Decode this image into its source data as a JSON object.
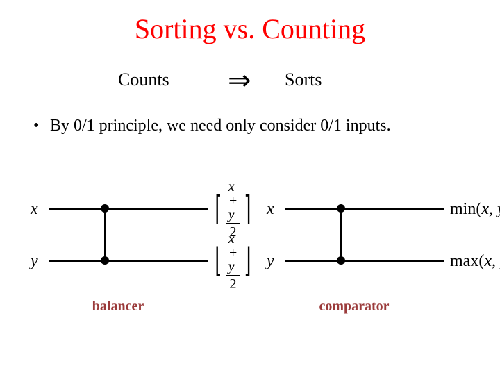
{
  "title": "Sorting vs. Counting",
  "implication": {
    "left": "Counts",
    "symbol": "⇒",
    "right": "Sorts"
  },
  "bullet": "By 0/1 principle, we need only consider 0/1 inputs.",
  "diagrams": {
    "balancer": {
      "in_top": "x",
      "in_bot": "y",
      "out_top": {
        "num": "x + y",
        "den": "2",
        "delim": "ceil"
      },
      "out_bot": {
        "num": "x + y",
        "den": "2",
        "delim": "floor"
      },
      "caption": "balancer"
    },
    "comparator": {
      "in_top": "x",
      "in_bot": "y",
      "out_top": {
        "fn": "min",
        "args": "x, y"
      },
      "out_bot": {
        "fn": "max",
        "args": "x, y"
      },
      "caption": "comparator"
    }
  }
}
